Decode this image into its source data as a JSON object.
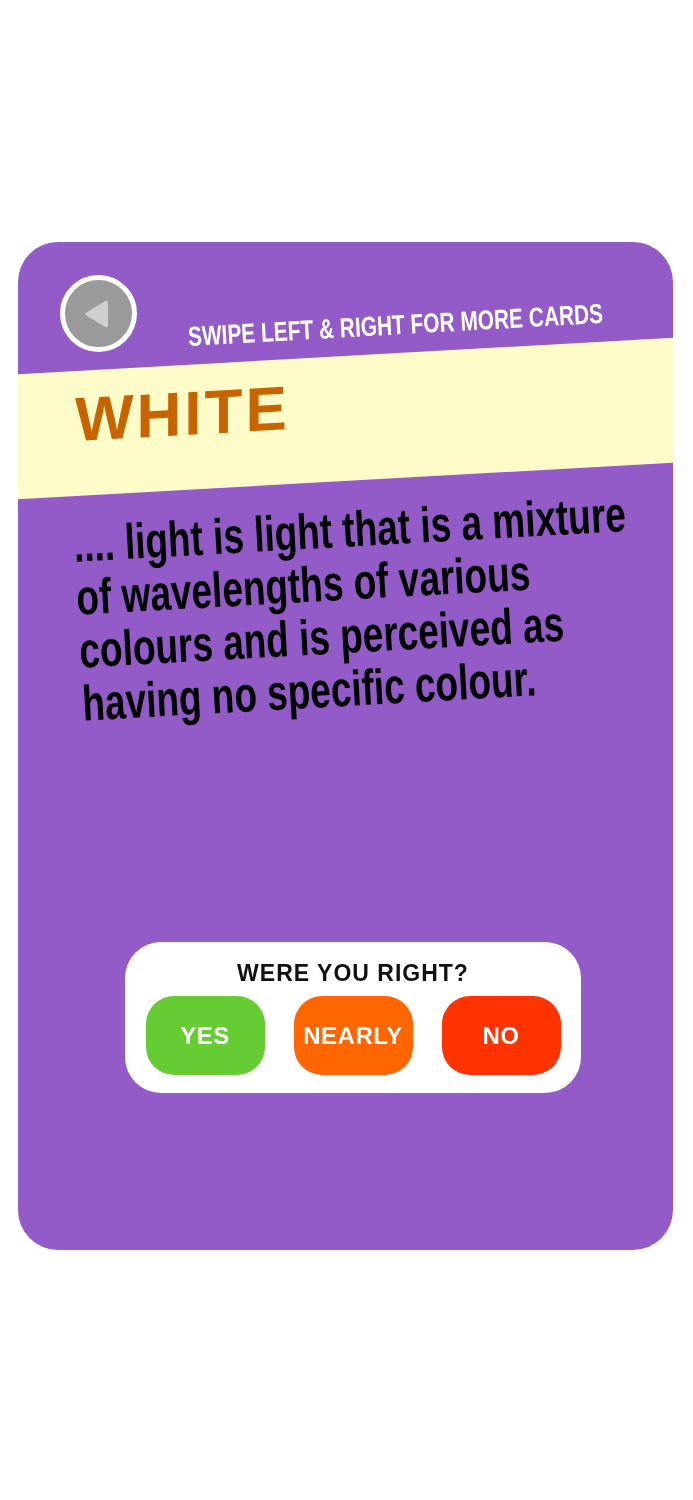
{
  "card": {
    "hint": "SWIPE LEFT & RIGHT FOR MORE CARDS",
    "term": "WHITE",
    "definition": ".... light is light that is a mixture of wavelengths of various colours and is perceived as having no specific colour."
  },
  "quiz": {
    "question": "WERE YOU RIGHT?",
    "answers": [
      {
        "label": "YES",
        "color": "#66cc33"
      },
      {
        "label": "NEARLY",
        "color": "#ff6600"
      },
      {
        "label": "NO",
        "color": "#ff3300"
      }
    ]
  }
}
